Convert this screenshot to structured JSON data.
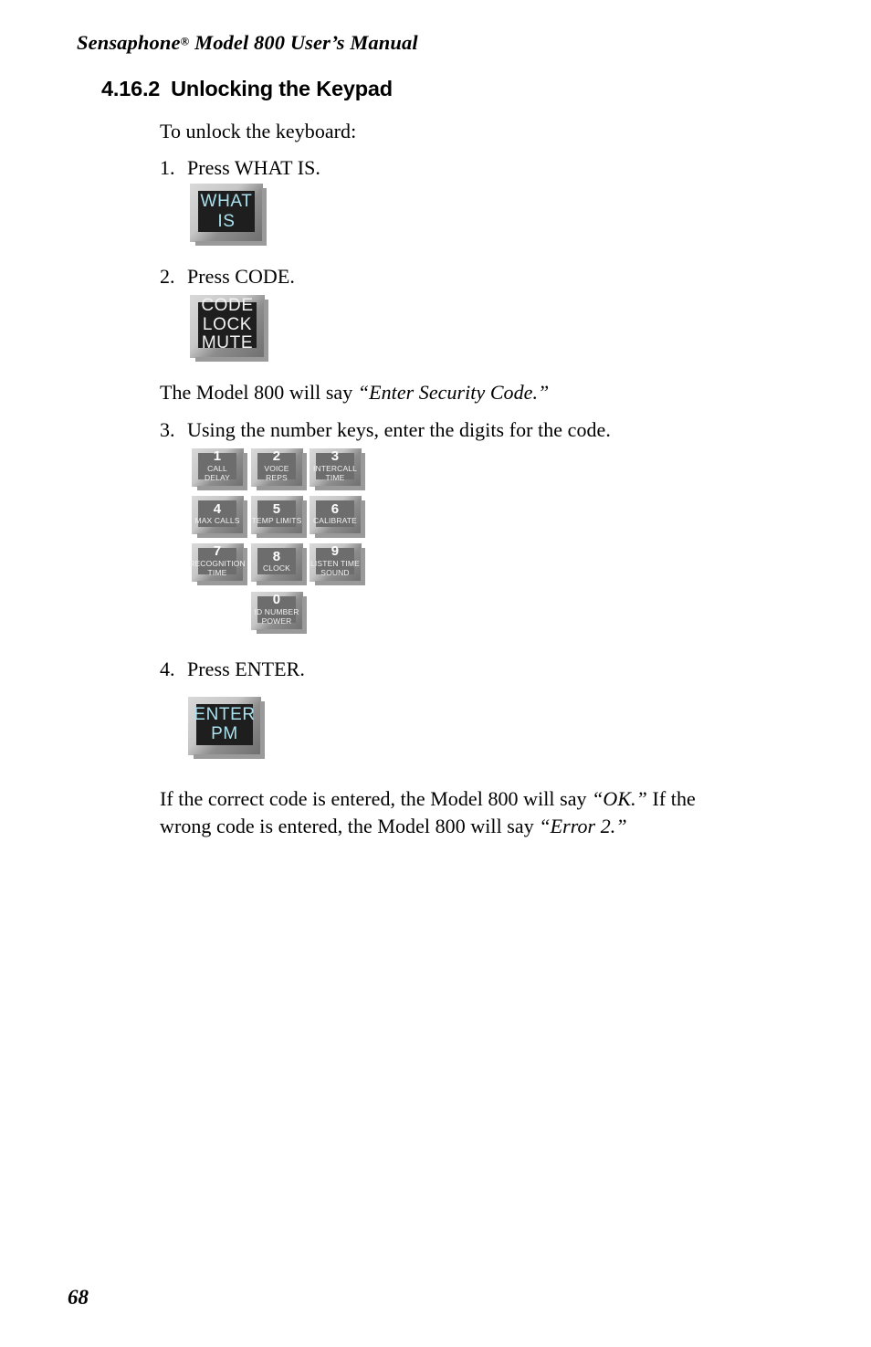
{
  "document": {
    "running_head": {
      "brand": "Sensaphone",
      "registered_mark": "®",
      "rest": " Model 800 User’s Manual"
    },
    "page_number": "68"
  },
  "section": {
    "number": "4.16.2",
    "title": "Unlocking the Keypad"
  },
  "body": {
    "intro": "To unlock the keyboard:",
    "step1": {
      "num": "1.",
      "text": "Press WHAT IS."
    },
    "step2": {
      "num": "2.",
      "text": "Press CODE."
    },
    "say_security_code": {
      "lead": "The Model 800 will say ",
      "quote": "“Enter Security Code.”"
    },
    "step3": {
      "num": "3.",
      "text": "Using the number keys, enter the digits for the code."
    },
    "step4": {
      "num": "4.",
      "text": "Press ENTER."
    },
    "closing": {
      "part1": "If the correct code is entered, the Model 800 will say ",
      "quote1": "“OK.”",
      "part2": "  If the wrong code is entered, the Model 800 will say ",
      "quote2": "“Error 2.”"
    }
  },
  "keys": {
    "what_is": {
      "line1": "WHAT",
      "line2": "IS",
      "text_color": "#a9e2ee",
      "face_color": "#1e1e1e"
    },
    "code": {
      "line1": "CODE",
      "line2": "LOCK",
      "line3": "MUTE",
      "text_color": "#f2f2f2",
      "face_color": "#1e1e1e"
    },
    "enter": {
      "line1": "ENTER",
      "line2": "PM",
      "text_color": "#a9e2ee",
      "face_color": "#1e1e1e"
    },
    "face_color_number": "#6d6d6d",
    "numbers": [
      {
        "digit": "1",
        "label1": "CALL",
        "label2": "DELAY"
      },
      {
        "digit": "2",
        "label1": "VOICE",
        "label2": "REPS"
      },
      {
        "digit": "3",
        "label1": "INTERCALL",
        "label2": "TIME"
      },
      {
        "digit": "4",
        "label1": "MAX CALLS",
        "label2": ""
      },
      {
        "digit": "5",
        "label1": "TEMP LIMITS",
        "label2": ""
      },
      {
        "digit": "6",
        "label1": "CALIBRATE",
        "label2": ""
      },
      {
        "digit": "7",
        "label1": "RECOGNITION",
        "label2": "TIME"
      },
      {
        "digit": "8",
        "label1": "CLOCK",
        "label2": ""
      },
      {
        "digit": "9",
        "label1": "LISTEN TIME",
        "label2": "SOUND"
      },
      {
        "digit": "0",
        "label1": "ID NUMBER",
        "label2": "POWER"
      }
    ]
  }
}
